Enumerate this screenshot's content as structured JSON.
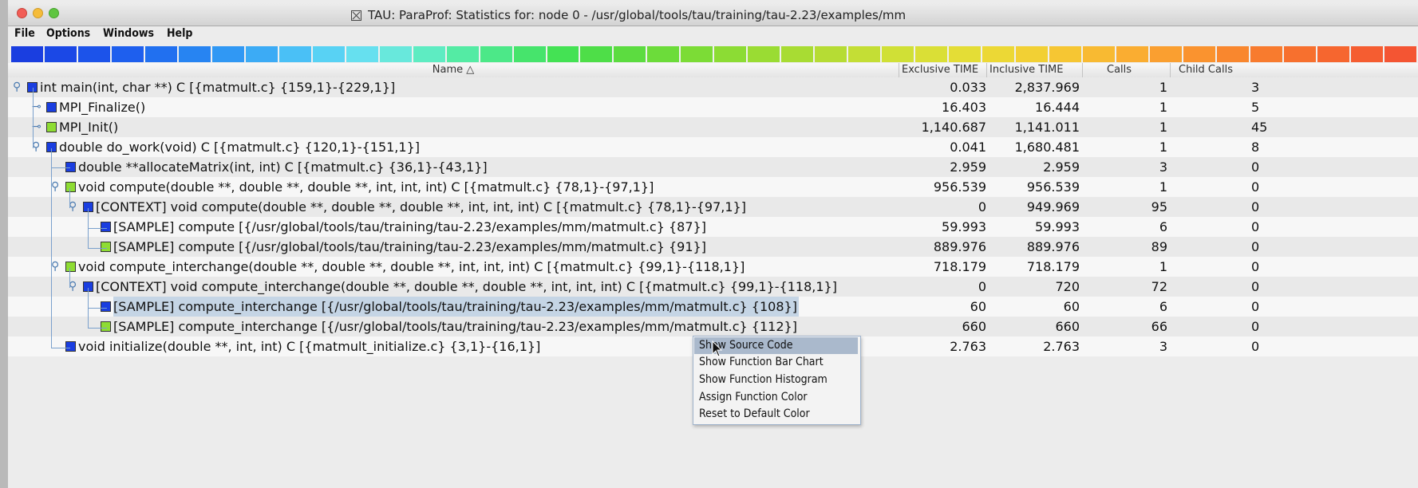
{
  "window": {
    "title": "TAU: ParaProf: Statistics for: node 0 - /usr/global/tools/tau/training/tau-2.23/examples/mm"
  },
  "menu": [
    "File",
    "Options",
    "Windows",
    "Help"
  ],
  "colorbar": [
    "#1a3ee0",
    "#1b48e6",
    "#1c53ea",
    "#1e5fee",
    "#2170f0",
    "#2784f2",
    "#3098f4",
    "#3cabf5",
    "#4ac0f6",
    "#58d2f4",
    "#66e0ef",
    "#68e8dc",
    "#5eecc2",
    "#54eba4",
    "#4ce888",
    "#46e46c",
    "#44e254",
    "#4ede48",
    "#5cdc40",
    "#6cdc3a",
    "#7cdc36",
    "#8cdc34",
    "#9adc33",
    "#a8dc33",
    "#b6dc34",
    "#c4de35",
    "#d0e036",
    "#dadf36",
    "#e4dd36",
    "#ecd835",
    "#f2d034",
    "#f6c633",
    "#f8ba32",
    "#faad31",
    "#fa9f30",
    "#fa932f",
    "#f9872e",
    "#f87b2e",
    "#f7702e",
    "#f6662f",
    "#f55d31",
    "#f45533"
  ],
  "columns": {
    "name": "Name △",
    "exclusive": "Exclusive TIME",
    "inclusive": "Inclusive TIME",
    "calls": "Calls",
    "child": "Child Calls"
  },
  "rows": [
    {
      "name": "int main(int, char **) C [{matmult.c} {159,1}-{229,1}]",
      "excl": "0.033",
      "incl": "2,837.969",
      "calls": "1",
      "child": "3",
      "color": "#1a3ee0",
      "level": 0,
      "toggle": "open"
    },
    {
      "name": "MPI_Finalize()",
      "excl": "16.403",
      "incl": "16.444",
      "calls": "1",
      "child": "5",
      "color": "#1a3ee0",
      "level": 1,
      "toggle": "closed"
    },
    {
      "name": "MPI_Init()",
      "excl": "1,140.687",
      "incl": "1,141.011",
      "calls": "1",
      "child": "45",
      "color": "#8edc33",
      "level": 1,
      "toggle": "closed"
    },
    {
      "name": "double do_work(void) C [{matmult.c} {120,1}-{151,1}]",
      "excl": "0.041",
      "incl": "1,680.481",
      "calls": "1",
      "child": "8",
      "color": "#1a3ee0",
      "level": 1,
      "toggle": "open"
    },
    {
      "name": "double **allocateMatrix(int, int) C [{matmult.c} {36,1}-{43,1}]",
      "excl": "2.959",
      "incl": "2.959",
      "calls": "3",
      "child": "0",
      "color": "#1a3ee0",
      "level": 2,
      "toggle": "none"
    },
    {
      "name": "void compute(double **, double **, double **, int, int, int) C [{matmult.c} {78,1}-{97,1}]",
      "excl": "956.539",
      "incl": "956.539",
      "calls": "1",
      "child": "0",
      "color": "#8edc33",
      "level": 2,
      "toggle": "open"
    },
    {
      "name": "[CONTEXT] void compute(double **, double **, double **, int, int, int) C [{matmult.c} {78,1}-{97,1}]",
      "excl": "0",
      "incl": "949.969",
      "calls": "95",
      "child": "0",
      "color": "#1a3ee0",
      "level": 3,
      "toggle": "open"
    },
    {
      "name": "[SAMPLE] compute [{/usr/global/tools/tau/training/tau-2.23/examples/mm/matmult.c} {87}]",
      "excl": "59.993",
      "incl": "59.993",
      "calls": "6",
      "child": "0",
      "color": "#1a3ee0",
      "level": 4,
      "toggle": "none"
    },
    {
      "name": "[SAMPLE] compute [{/usr/global/tools/tau/training/tau-2.23/examples/mm/matmult.c} {91}]",
      "excl": "889.976",
      "incl": "889.976",
      "calls": "89",
      "child": "0",
      "color": "#8edc33",
      "level": 4,
      "toggle": "none"
    },
    {
      "name": "void compute_interchange(double **, double **, double **, int, int, int) C [{matmult.c} {99,1}-{118,1}]",
      "excl": "718.179",
      "incl": "718.179",
      "calls": "1",
      "child": "0",
      "color": "#8edc33",
      "level": 2,
      "toggle": "open"
    },
    {
      "name": "[CONTEXT] void compute_interchange(double **, double **, double **, int, int, int) C [{matmult.c} {99,1}-{118,1}]",
      "excl": "0",
      "incl": "720",
      "calls": "72",
      "child": "0",
      "color": "#1a3ee0",
      "level": 3,
      "toggle": "open"
    },
    {
      "name": "[SAMPLE] compute_interchange [{/usr/global/tools/tau/training/tau-2.23/examples/mm/matmult.c} {108}]",
      "excl": "60",
      "incl": "60",
      "calls": "6",
      "child": "0",
      "color": "#1a3ee0",
      "level": 4,
      "toggle": "none",
      "selected": true
    },
    {
      "name": "[SAMPLE] compute_interchange [{/usr/global/tools/tau/training/tau-2.23/examples/mm/matmult.c} {112}]",
      "excl": "660",
      "incl": "660",
      "calls": "66",
      "child": "0",
      "color": "#8edc33",
      "level": 4,
      "toggle": "none"
    },
    {
      "name": "void initialize(double **, int, int) C [{matmult_initialize.c} {3,1}-{16,1}]",
      "excl": "2.763",
      "incl": "2.763",
      "calls": "3",
      "child": "0",
      "color": "#1a3ee0",
      "level": 2,
      "toggle": "none"
    }
  ],
  "context_menu": {
    "items": [
      "Show Source Code",
      "Show Function Bar Chart",
      "Show Function Histogram",
      "Assign Function Color",
      "Reset to Default Color"
    ],
    "highlighted": 0
  }
}
